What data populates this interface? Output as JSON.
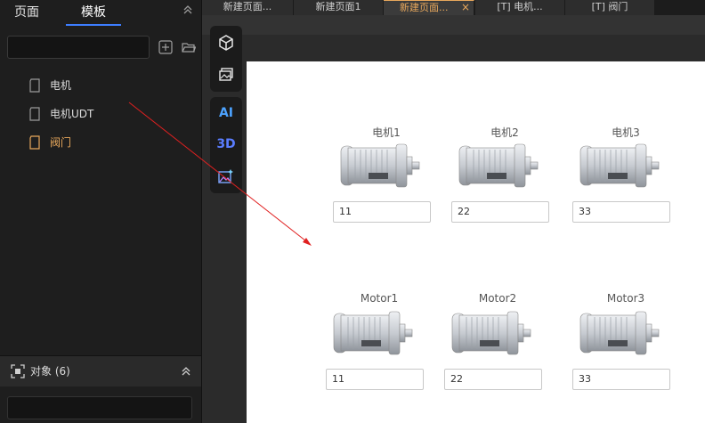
{
  "left_panel": {
    "tabs": {
      "pages": "页面",
      "templates": "模板"
    },
    "tree": [
      {
        "label": "电机",
        "active": false
      },
      {
        "label": "电机UDT",
        "active": false
      },
      {
        "label": "阀门",
        "active": true
      }
    ],
    "objects_label": "对象 (6)"
  },
  "page_tabs": [
    "新建页面...",
    "新建页面1",
    "新建页面...",
    "[T] 电机...",
    "[T] 阀门"
  ],
  "page_tab_close": "×",
  "toolbar": {
    "ai_label": "AI",
    "three_d_label": "3D"
  },
  "motors": [
    {
      "label": "电机1",
      "value": "11"
    },
    {
      "label": "电机2",
      "value": "22"
    },
    {
      "label": "电机3",
      "value": "33"
    },
    {
      "label": "Motor1",
      "value": "11"
    },
    {
      "label": "Motor2",
      "value": "22"
    },
    {
      "label": "Motor3",
      "value": "33"
    }
  ],
  "colors": {
    "accent": "#3d7eff",
    "active_tab": "#e8a85c",
    "panel": "#1e1e1e",
    "canvas": "#ffffff"
  }
}
